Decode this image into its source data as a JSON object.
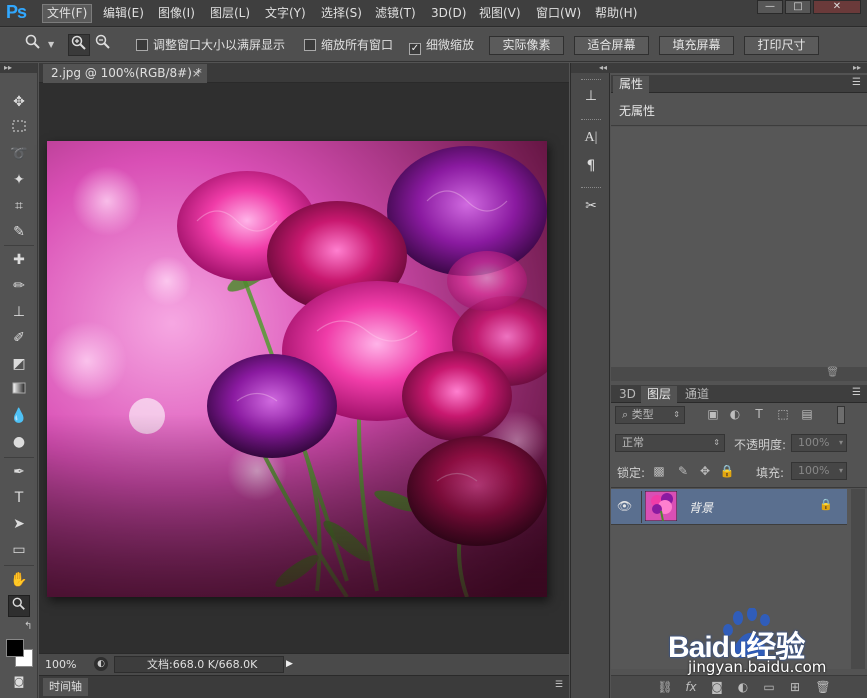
{
  "app": {
    "logo": "Ps"
  },
  "menu": [
    "文件(F)",
    "编辑(E)",
    "图像(I)",
    "图层(L)",
    "文字(Y)",
    "选择(S)",
    "滤镜(T)",
    "3D(D)",
    "视图(V)",
    "窗口(W)",
    "帮助(H)"
  ],
  "window_controls": {
    "minimize": "—",
    "maximize": "□",
    "close": "✕"
  },
  "options": {
    "resize_windows": "调整窗口大小以满屏显示",
    "zoom_all": "缩放所有窗口",
    "scrubby_zoom": "细微缩放",
    "resize_checked": false,
    "zoom_all_checked": false,
    "scrubby_checked": true,
    "buttons": [
      "实际像素",
      "适合屏幕",
      "填充屏幕",
      "打印尺寸"
    ]
  },
  "document": {
    "tab_title": "2.jpg @ 100%(RGB/8#) *",
    "close": "×",
    "zoom": "100%",
    "doc_size": "文档:668.0 K/668.0K"
  },
  "timeline": {
    "label": "时间轴"
  },
  "properties": {
    "tab": "属性",
    "content": "无属性"
  },
  "layers": {
    "tabs": [
      "3D",
      "图层",
      "通道"
    ],
    "active_tab": "图层",
    "filter_kind": "类型",
    "blend_mode": "正常",
    "opacity_label": "不透明度:",
    "opacity_value": "100%",
    "lock_label": "锁定:",
    "fill_label": "填充:",
    "fill_value": "100%",
    "items": [
      {
        "name": "背景",
        "visible": true,
        "locked": true
      }
    ]
  },
  "watermark": {
    "brand": "Baidu经验",
    "url": "jingyan.baidu.com"
  },
  "colors": {
    "accent": "#31a8ff",
    "layer_selected": "#5a6f8f",
    "brand_blue": "#2d5fc6",
    "brand_red": "#e23b2f"
  }
}
